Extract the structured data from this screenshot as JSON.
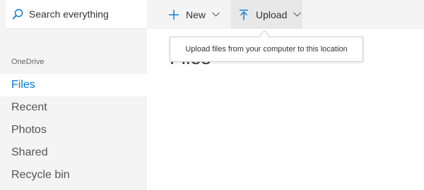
{
  "search": {
    "label": "Search everything",
    "icon": "search-icon"
  },
  "sidebar": {
    "heading": "OneDrive",
    "items": [
      {
        "label": "Files",
        "selected": true
      },
      {
        "label": "Recent",
        "selected": false
      },
      {
        "label": "Photos",
        "selected": false
      },
      {
        "label": "Shared",
        "selected": false
      },
      {
        "label": "Recycle bin",
        "selected": false
      }
    ]
  },
  "toolbar": {
    "new": {
      "label": "New",
      "icon": "plus-icon"
    },
    "upload": {
      "label": "Upload",
      "icon": "upload-arrow-icon"
    }
  },
  "main": {
    "title": "Files"
  },
  "tooltip": {
    "text": "Upload files from your computer to this location"
  },
  "colors": {
    "accent": "#0078d7",
    "sidebar_bg": "#f4f4f4",
    "selected_bg": "#ffffff",
    "command_hover_bg": "#e8e8e8",
    "text": "#333333"
  }
}
